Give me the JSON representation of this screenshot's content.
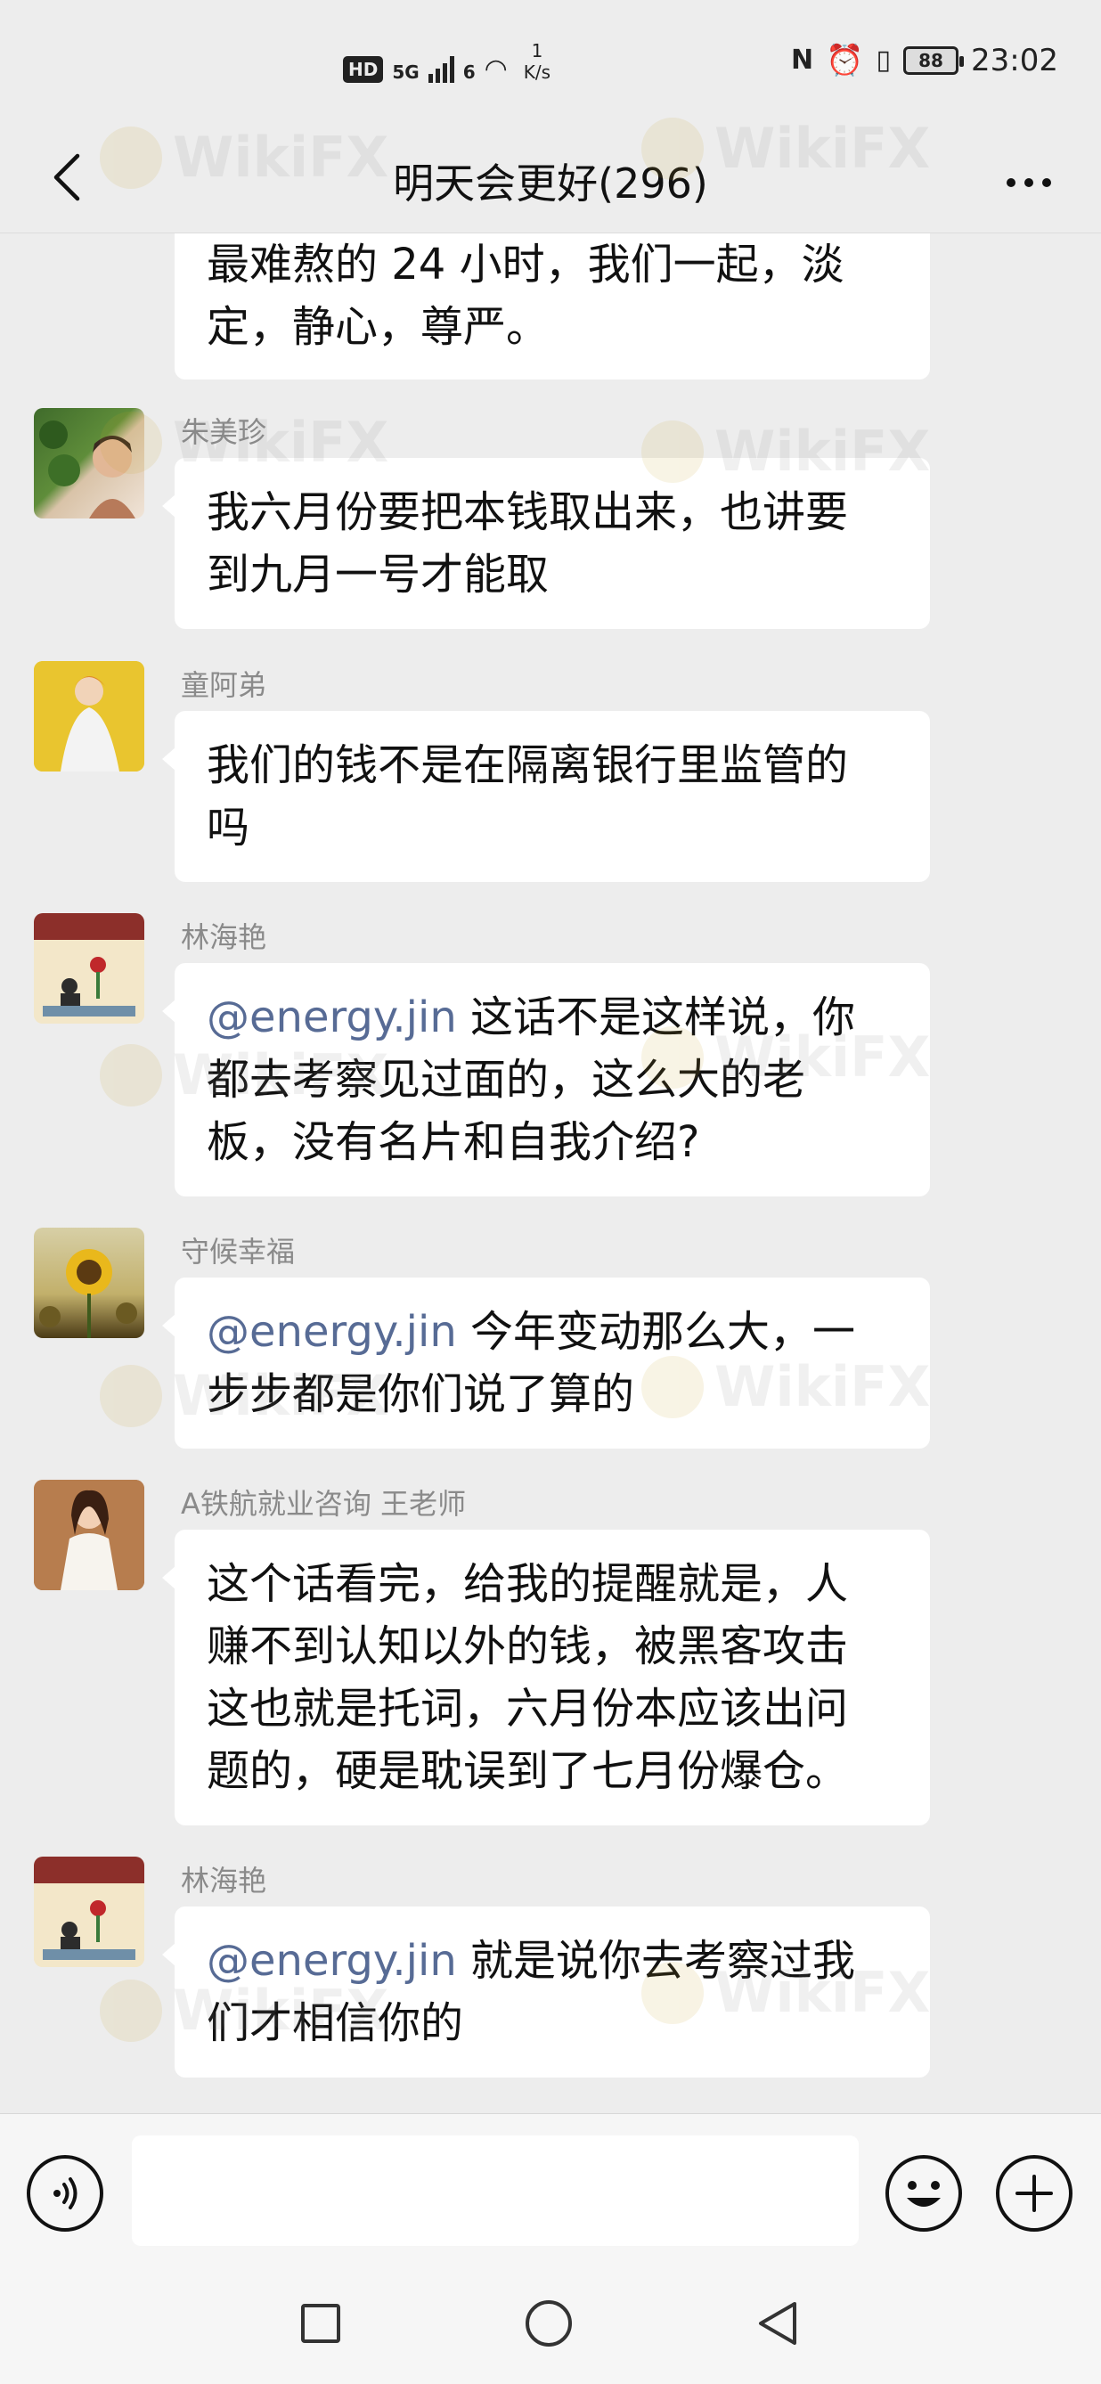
{
  "status_bar": {
    "hd": "HD",
    "network": "5G",
    "wifi": "6",
    "speed_value": "1",
    "speed_unit": "K/s",
    "battery": "88",
    "time": "23:02"
  },
  "header": {
    "title": "明天会更好(296)"
  },
  "watermark": "WikiFX",
  "messages": [
    {
      "sender": "",
      "lines": [
        "最难熬的 24 小时，我们一起，淡",
        "定，静心，尊严。"
      ]
    },
    {
      "sender": "朱美珍",
      "lines": [
        "我六月份要把本钱取出来，也讲要",
        "到九月一号才能取"
      ]
    },
    {
      "sender": "童阿弟",
      "lines": [
        "我们的钱不是在隔离银行里监管的",
        "吗"
      ]
    },
    {
      "sender": "林海艳",
      "mention": "@energy.jin",
      "lines": [
        " 这话不是这样说，你",
        "都去考察见过面的，这么大的老",
        "板，没有名片和自我介绍?"
      ]
    },
    {
      "sender": "守候幸福",
      "mention": "@energy.jin",
      "lines": [
        " 今年变动那么大，一",
        "步步都是你们说了算的"
      ]
    },
    {
      "sender": "A铁航就业咨询 王老师",
      "lines": [
        "这个话看完，给我的提醒就是，人",
        "赚不到认知以外的钱，被黑客攻击",
        "这也就是托词，六月份本应该出问",
        "题的，硬是耽误到了七月份爆仓。"
      ]
    },
    {
      "sender": "林海艳",
      "mention": "@energy.jin",
      "lines": [
        " 就是说你去考察过我",
        "们才相信你的"
      ]
    }
  ],
  "input_bar": {
    "value": ""
  },
  "colors": {
    "background": "#ededed",
    "bubble": "#ffffff",
    "mention": "#576b95",
    "sender": "#8a8a8a"
  },
  "icons": [
    "back-arrow-icon",
    "more-icon",
    "voice-icon",
    "emoji-icon",
    "plus-icon",
    "nav-square-icon",
    "nav-home-icon",
    "nav-back-icon"
  ]
}
